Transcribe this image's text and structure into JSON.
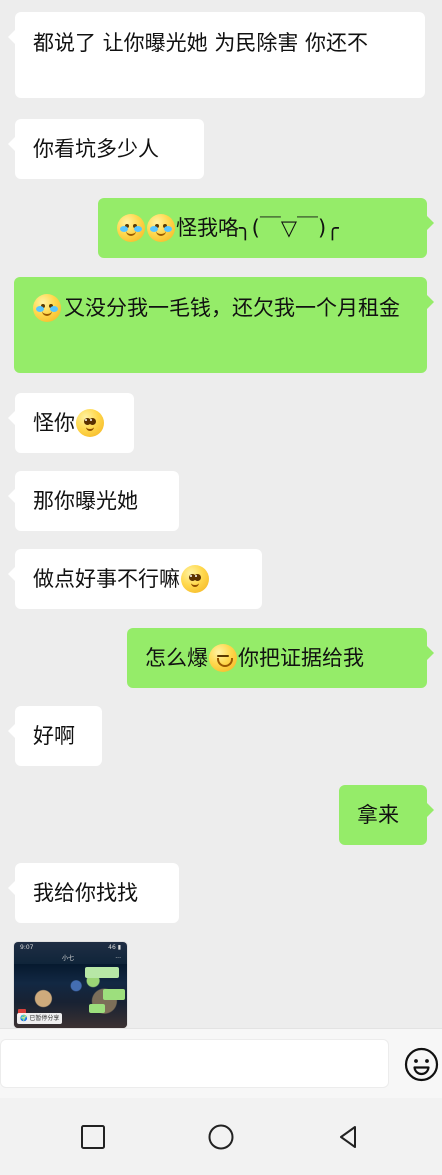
{
  "messages": [
    {
      "side": "left",
      "text": "都说了 让你曝光她 为民除害  你还不"
    },
    {
      "side": "left",
      "text": "你看坑多少人"
    },
    {
      "side": "right",
      "emoji": [
        "crying-face",
        "crying-face"
      ],
      "text": "怪我咯╮(￣▽￣)╭"
    },
    {
      "side": "right",
      "emoji": [
        "crying-face"
      ],
      "text": "又没分我一毛钱，还欠我一个月租金"
    },
    {
      "side": "left",
      "text": "怪你",
      "emoji": [
        "pleading-face"
      ]
    },
    {
      "side": "left",
      "text": "那你曝光她"
    },
    {
      "side": "left",
      "text": "做点好事不行嘛",
      "emoji": [
        "pleading-face"
      ]
    },
    {
      "side": "right",
      "text_before": "怎么爆",
      "emoji": [
        "grimacing-face"
      ],
      "text_after": "你把证据给我"
    },
    {
      "side": "left",
      "text": "好啊"
    },
    {
      "side": "right",
      "text": "拿来"
    },
    {
      "side": "left",
      "text": "我给你找找"
    },
    {
      "side": "left",
      "type": "image",
      "preview": {
        "time": "9:07",
        "status": "46 ▮",
        "title": "小七",
        "menu": "···",
        "caption": "🌍 已暂停分享"
      }
    }
  ],
  "input_bar": {
    "placeholder": "",
    "emoji_button": "emoji-icon"
  },
  "navigation": {
    "items": [
      "square-icon",
      "circle-icon",
      "back-triangle-icon"
    ]
  },
  "colors": {
    "background": "#ededed",
    "left_bubble": "#ffffff",
    "right_bubble": "#95ec69",
    "text": "#111111",
    "input_bar": "#f7f7f7",
    "nav_bar": "#f2f2f2"
  }
}
